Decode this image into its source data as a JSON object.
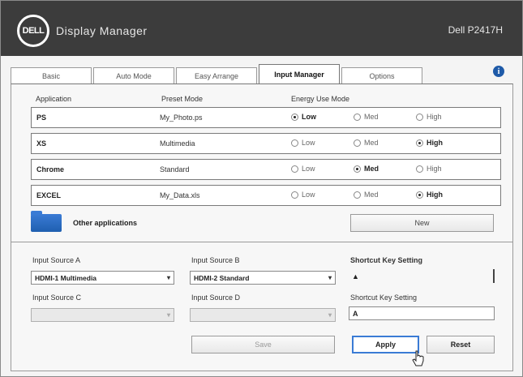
{
  "app": {
    "logo_text": "DELL",
    "title": "Display Manager",
    "version": "Dell P2417H"
  },
  "tabs": [
    {
      "label": "Basic",
      "active": false
    },
    {
      "label": "Auto Mode",
      "active": false
    },
    {
      "label": "Easy Arrange",
      "active": false
    },
    {
      "label": "Input Manager",
      "active": true
    },
    {
      "label": "Options",
      "active": false
    }
  ],
  "columns": {
    "application": "Application",
    "preset": "Preset Mode",
    "energy": "Energy Use Mode"
  },
  "rows": [
    {
      "name": "PS",
      "preset": "My_Photo.ps",
      "options": [
        "Low",
        "Med",
        "High"
      ],
      "selected": 0
    },
    {
      "name": "XS",
      "preset": "Multimedia",
      "options": [
        "Low",
        "Med",
        "High"
      ],
      "selected": 2
    },
    {
      "name": "Chrome",
      "preset": "Standard",
      "options": [
        "Low",
        "Med",
        "High"
      ],
      "selected": 1
    },
    {
      "name": "EXCEL",
      "preset": "My_Data.xls",
      "options": [
        "Low",
        "Med",
        "High"
      ],
      "selected": 2
    }
  ],
  "more_apps": {
    "label": "Other applications"
  },
  "buttons": {
    "new": "New",
    "save": "Save",
    "apply": "Apply",
    "reset": "Reset"
  },
  "left_group": {
    "label": "Input Source A",
    "value": "HDMI-1 Multimedia",
    "label2": "Input Source C",
    "value2": ""
  },
  "mid_group": {
    "label": "Input Source B",
    "value": "HDMI-2 Standard",
    "label2": "Input Source D",
    "value2": ""
  },
  "right_group": {
    "label": "Shortcut Key Setting",
    "key_value": "▲",
    "label2": "Shortcut Key Setting",
    "text_value": "A"
  },
  "colors": {
    "titlebar": "#3c3c3c",
    "accent": "#3a7bd5"
  }
}
